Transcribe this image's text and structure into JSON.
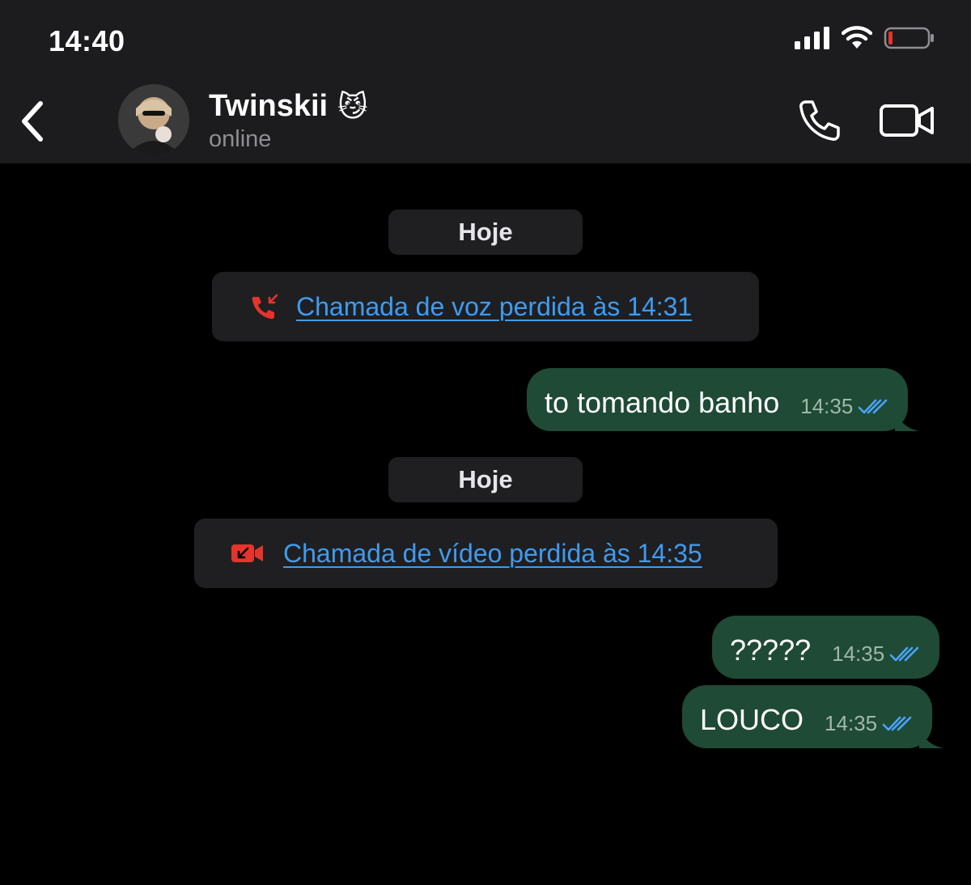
{
  "status_bar": {
    "time": "14:40"
  },
  "header": {
    "contact_name": "Twinskii",
    "contact_emoji": "😼",
    "contact_status": "online",
    "icons": [
      "chevron-left-icon",
      "phone-icon",
      "video-camera-icon"
    ]
  },
  "messages": {
    "date_1": "Hoje",
    "call_1": "Chamada de voz perdida às 14:31",
    "msg_1": {
      "text": "to tomando banho",
      "time": "14:35"
    },
    "date_2": "Hoje",
    "call_2": "Chamada de vídeo perdida às 14:35",
    "msg_2": {
      "text": "?????",
      "time": "14:35"
    },
    "msg_3": {
      "text": "LOUCO",
      "time": "14:35"
    }
  },
  "colors": {
    "header_bg": "#1c1c1e",
    "outgoing_bubble": "#1f4a35",
    "missed_call_red": "#e5342c",
    "link_blue": "#3f9bf0",
    "read_receipt_blue": "#4aa3ff"
  }
}
